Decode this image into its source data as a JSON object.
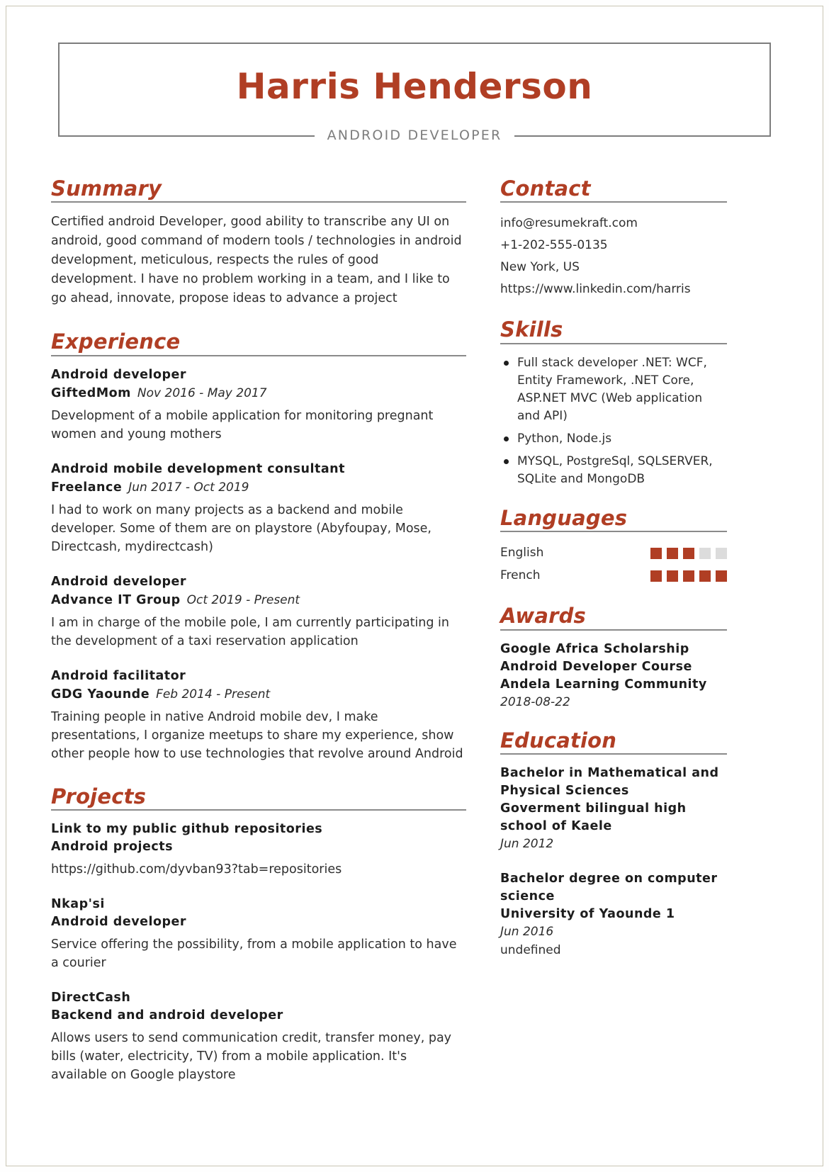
{
  "theme": {
    "accent": "#b03e24",
    "rule": "#8a8a8a",
    "text": "#2f2f2f",
    "muted": "#7d7d7d",
    "square_on": "#b03e24",
    "square_off": "#dcdcdc"
  },
  "header": {
    "name": "Harris Henderson",
    "title": "ANDROID DEVELOPER"
  },
  "summary": {
    "heading": "Summary",
    "text": "Certified android Developer, good ability to transcribe any UI on android, good command of modern tools / technologies in android development, meticulous, respects the rules of good development. I have no problem working in a team, and I like to go ahead, innovate, propose ideas to advance a project"
  },
  "experience": {
    "heading": "Experience",
    "entries": [
      {
        "role": "Android developer",
        "org": "GiftedMom",
        "dates": "Nov 2016 - May 2017",
        "description": "Development of a mobile application for monitoring pregnant women and young mothers"
      },
      {
        "role": "Android mobile development consultant",
        "org": "Freelance",
        "dates": "Jun 2017 - Oct 2019",
        "description": "I had to work on many projects as a backend and mobile developer. Some of them are on playstore (Abyfoupay, Mose, Directcash, mydirectcash)"
      },
      {
        "role": "Android developer",
        "org": "Advance IT Group",
        "dates": "Oct 2019 - Present",
        "description": "I am in charge of the mobile pole, I am currently participating in the development of a taxi reservation application"
      },
      {
        "role": "Android facilitator",
        "org": "GDG Yaounde",
        "dates": "Feb 2014 - Present",
        "description": "Training people in native Android mobile dev, I make presentations, I organize meetups to share my experience, show other people how to use technologies that revolve around Android"
      }
    ]
  },
  "projects": {
    "heading": "Projects",
    "entries": [
      {
        "name": "Link to my public github repositories",
        "role": "Android projects",
        "description": "https://github.com/dyvban93?tab=repositories"
      },
      {
        "name": "Nkap'si",
        "role": "Android developer",
        "description": "Service offering the possibility, from a mobile application to have a courier"
      },
      {
        "name": "DirectCash",
        "role": "Backend and android developer",
        "description": "Allows users to send communication credit, transfer money, pay bills (water, electricity, TV) from a mobile application. It's available on Google playstore"
      }
    ]
  },
  "contact": {
    "heading": "Contact",
    "email": "info@resumekraft.com",
    "phone": "+1-202-555-0135",
    "location": "New York, US",
    "linkedin": "https://www.linkedin.com/harris"
  },
  "skills": {
    "heading": "Skills",
    "items": [
      "Full stack developer .NET: WCF, Entity Framework, .NET Core, ASP.NET MVC (Web application and API)",
      "Python, Node.js",
      "MYSQL, PostgreSql, SQLSERVER, SQLite and MongoDB"
    ]
  },
  "languages": {
    "heading": "Languages",
    "max_level": 5,
    "items": [
      {
        "name": "English",
        "level": 3
      },
      {
        "name": "French",
        "level": 5
      }
    ]
  },
  "awards": {
    "heading": "Awards",
    "entries": [
      {
        "line1": "Google Africa Scholarship",
        "line2": "Android Developer Course",
        "line3": "Andela Learning Community",
        "date": "2018-08-22"
      }
    ]
  },
  "education": {
    "heading": "Education",
    "entries": [
      {
        "degree_line1": "Bachelor in Mathematical and",
        "degree_line2": "Physical Sciences",
        "school_line1": "Goverment bilingual high",
        "school_line2": "school of Kaele",
        "date": "Jun 2012",
        "note": ""
      },
      {
        "degree_line1": "Bachelor degree on computer",
        "degree_line2": "science",
        "school_line1": "University of Yaounde 1",
        "school_line2": "",
        "date": "Jun 2016",
        "note": "undefined"
      }
    ]
  }
}
